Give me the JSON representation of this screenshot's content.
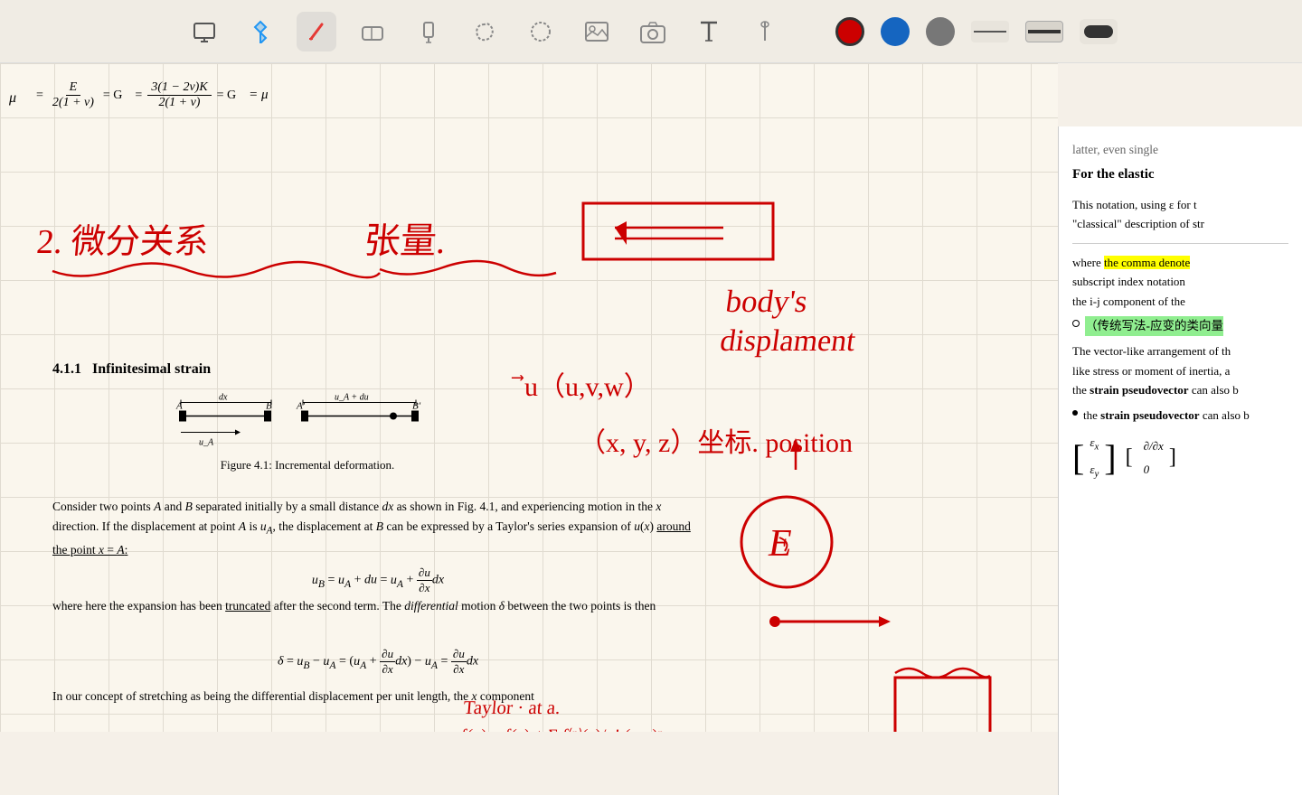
{
  "toolbar": {
    "tools": [
      {
        "name": "whiteboard-icon",
        "label": "Whiteboard",
        "symbol": "⬜",
        "active": false
      },
      {
        "name": "pen-icon",
        "label": "Pen",
        "symbol": "✏️",
        "active": true
      },
      {
        "name": "eraser-icon",
        "label": "Eraser",
        "symbol": "◇",
        "active": false
      },
      {
        "name": "highlighter-icon",
        "label": "Highlighter",
        "symbol": "🖊",
        "active": false
      },
      {
        "name": "lasso-icon",
        "label": "Lasso",
        "symbol": "⬟",
        "active": false
      },
      {
        "name": "shape-icon",
        "label": "Shape",
        "symbol": "◯",
        "active": false
      },
      {
        "name": "image-icon",
        "label": "Image",
        "symbol": "🖼",
        "active": false
      },
      {
        "name": "camera-icon",
        "label": "Camera",
        "symbol": "📷",
        "active": false
      },
      {
        "name": "text-icon",
        "label": "Text",
        "symbol": "T",
        "active": false
      },
      {
        "name": "pen2-icon",
        "label": "Pen2",
        "symbol": "∕",
        "active": false
      }
    ],
    "colors": [
      {
        "name": "red",
        "hex": "#cc0000",
        "selected": true
      },
      {
        "name": "blue",
        "hex": "#1565c0",
        "selected": false
      },
      {
        "name": "gray",
        "hex": "#777777",
        "selected": false
      }
    ],
    "line_sizes": [
      "thin",
      "medium",
      "thick"
    ]
  },
  "formula_row": {
    "mu": "μ",
    "items": [
      {
        "equals": "=",
        "frac_num": "E",
        "frac_den": "2(1 + ν)",
        "equals2": "= G"
      },
      {
        "equals": "=",
        "frac_num": "3(1 − 2ν)K",
        "frac_den": "2(1 + ν)",
        "equals2": "= G"
      },
      {
        "equals": "= μ"
      }
    ]
  },
  "section": {
    "number": "4.1.1",
    "title": "Infinitesimal strain"
  },
  "figure": {
    "caption": "Figure 4.1: Incremental deformation."
  },
  "textbook": {
    "para1": "Consider two points A and B separated initially by a small distance dx as shown in Fig. 4.1, and experiencing motion in the x direction. If the displacement at point A is u_A, the displacement at B can be expressed by a Taylor's series expansion of u(x) around the point x = A:",
    "eq1": "u_B = u_A + du = u_A + (∂u/∂x)dx",
    "para2": "where here the expansion has been truncated after the second term. The differential motion δ between the two points is then",
    "eq2": "δ = u_B − u_A = (u_A + (∂u/∂x)dx) − u_A = (∂u/∂x)dx",
    "para3": "In our concept of stretching as being the differential displacement per unit length, the x component"
  },
  "sidebar": {
    "header_text": "For the elastic",
    "text1": "latter, even single",
    "text2": "For the elastic",
    "para1": "This notation, using ε for t",
    "para1_cont": "\"classical\" description of str",
    "para2_prefix": "where ",
    "para2_highlight": "the comma denote",
    "para2_cont": "subscript index notation",
    "para2_cont2": "the i-j component of the",
    "bullet1": "（传统写法-应变的类向量",
    "bullet1_highlight": true,
    "para3": "The vector-like arrangement of th",
    "para3_cont": "like stress or moment of inertia, a",
    "para3_cont2": "the strain pseudovector can also b",
    "bullet2_label": "strain pseudovector",
    "matrix_labels": [
      "ε_x",
      "ε_y"
    ],
    "matrix2_labels": [
      "∂/∂x",
      "0"
    ]
  },
  "handwriting": {
    "chinese1": "2. 微分关系",
    "chinese2": "张量",
    "english1": "body's",
    "english2": "displament",
    "english3": "u⃗ (u,v,w)",
    "english4": "(x, y, z) 坐标. position",
    "english5": "Taylor·at a.",
    "english6": "f(x) = f(a) + Σ f^n(a)/n! (x-a)^n"
  }
}
